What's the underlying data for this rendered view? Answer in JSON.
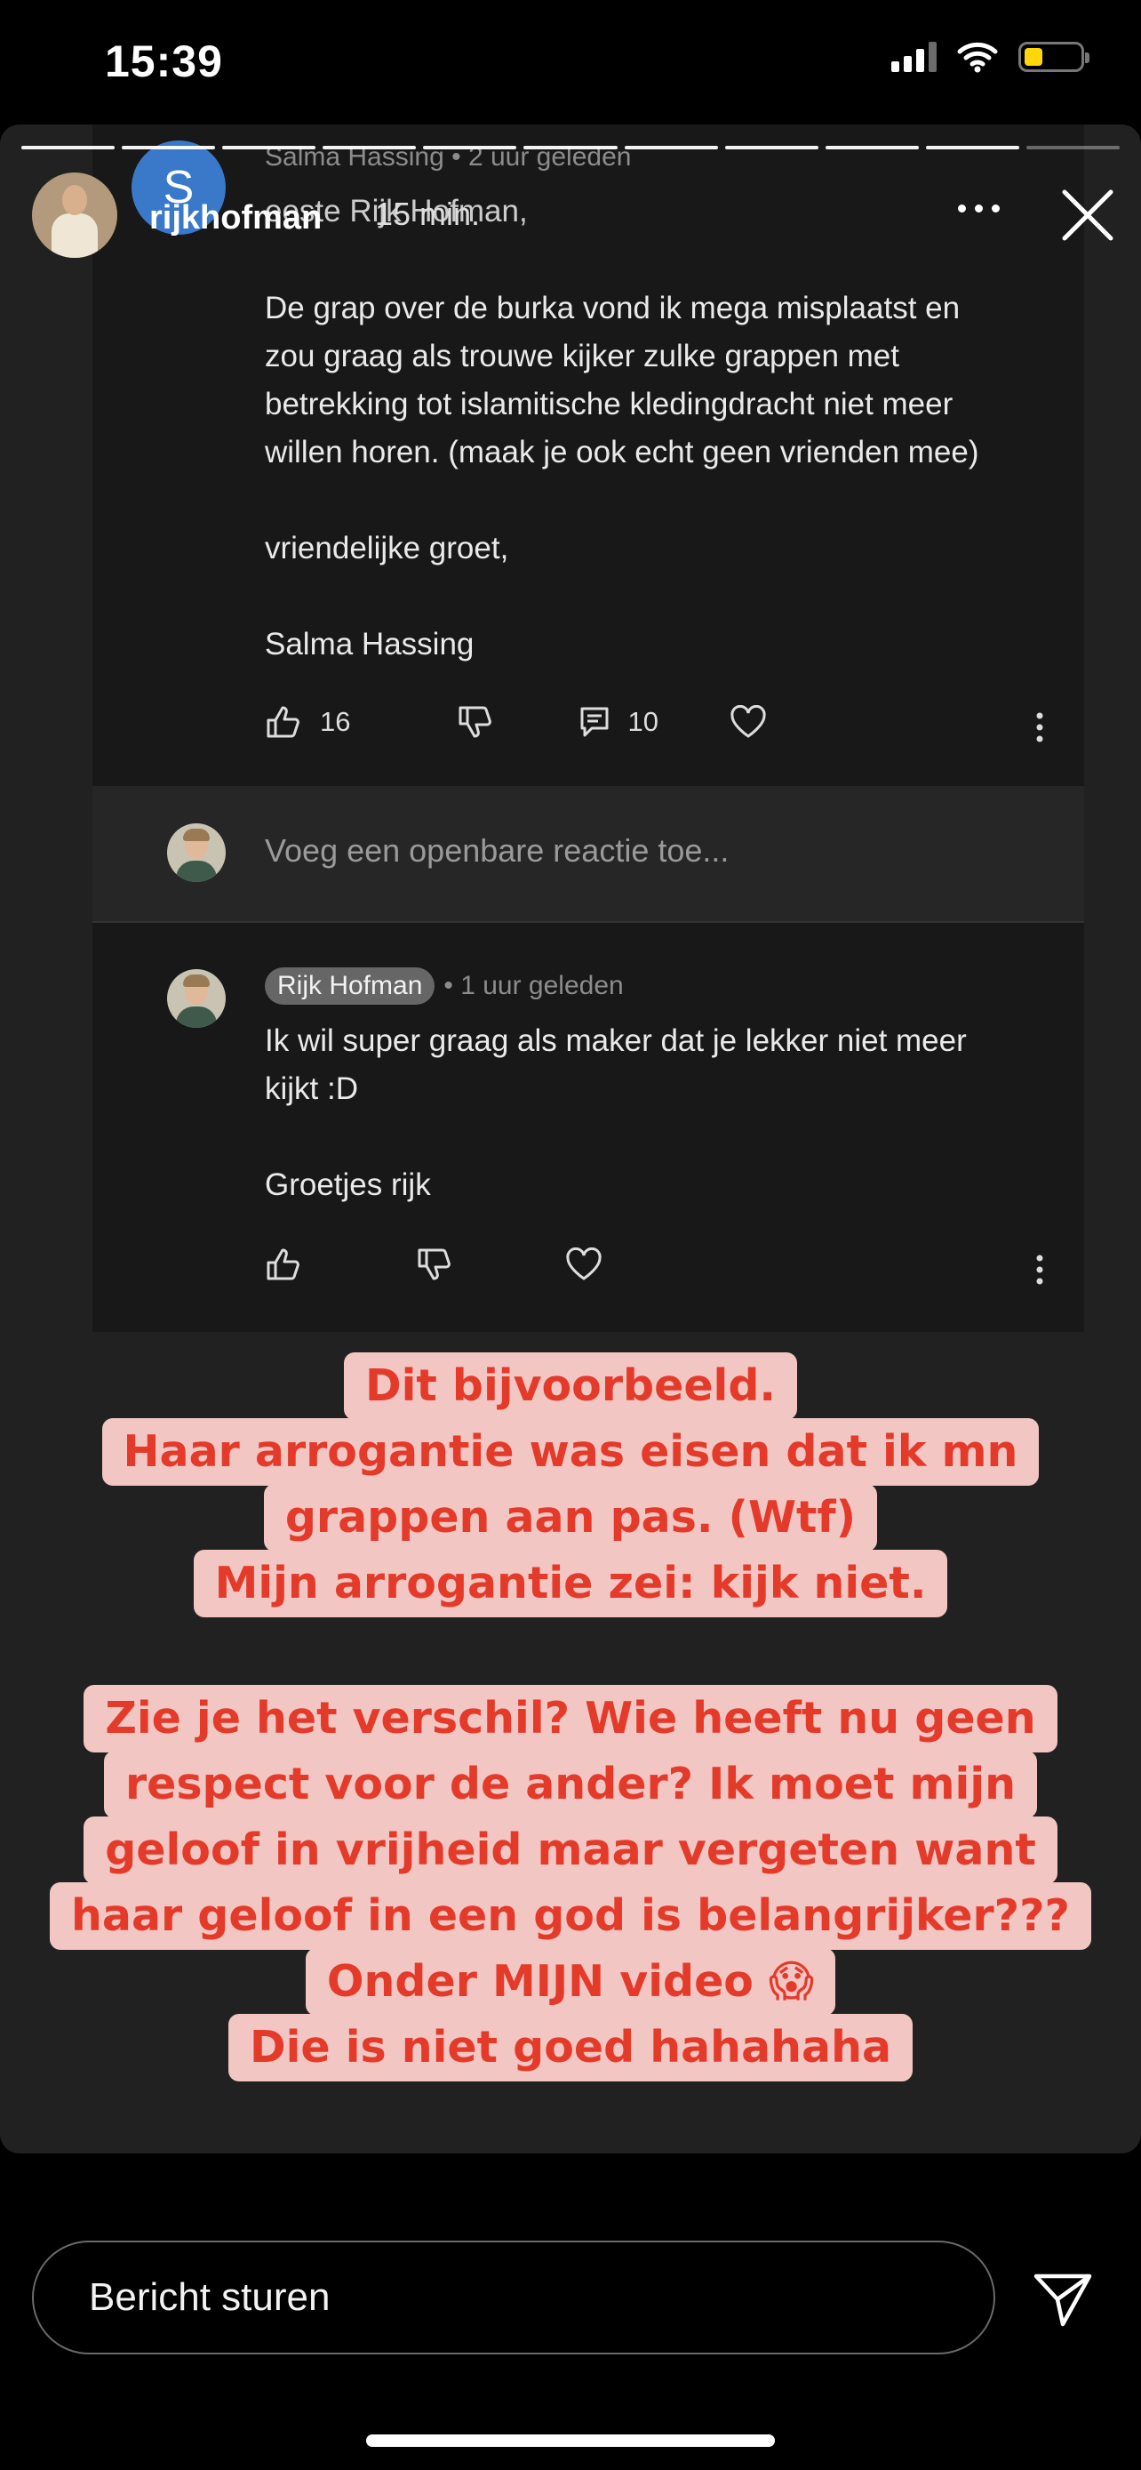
{
  "status_bar": {
    "time": "15:39"
  },
  "story": {
    "username": "rijkhofman",
    "progress": {
      "total_segments": 11,
      "completed_segments": 10
    }
  },
  "screenshot": {
    "comment": {
      "avatar_letter": "S",
      "author": "Salma Hassing",
      "time": "• 2 uur geleden",
      "salutation_fragment": "eeste Rijk Hofman,",
      "overlay_time_fragment": "15 min.",
      "body": "De grap over de burka vond ik mega misplaatst en\nzou graag als trouwe kijker zulke grappen met\nbetrekking tot islamitische kledingdracht niet meer\nwillen horen. (maak je ook echt geen vrienden mee)",
      "closing": "vriendelijke groet,",
      "signature": "Salma Hassing",
      "likes": "16",
      "replies": "10"
    },
    "reply_input_placeholder": "Voeg een openbare reactie toe...",
    "reply": {
      "author_badge": "Rijk Hofman",
      "time": "• 1 uur geleden",
      "body": "Ik wil super graag als maker dat je lekker niet meer\nkijkt :D",
      "signoff": "Groetjes rijk"
    }
  },
  "captions": {
    "block1": [
      "Dit bijvoorbeeld.",
      "Haar arrogantie was eisen dat ik mn",
      "grappen aan pas. (Wtf)",
      "Mijn arrogantie zei: kijk niet."
    ],
    "block2": [
      "Zie je het verschil? Wie heeft nu geen",
      "respect voor de ander? Ik moet mijn",
      "geloof in vrijheid maar vergeten want",
      "haar geloof in een god is belangrijker???",
      "Onder MIJN video 😱",
      "Die is niet goed hahahaha"
    ]
  },
  "bottom_bar": {
    "message_placeholder": "Bericht sturen"
  },
  "colors": {
    "caption_text": "#e33a2a",
    "caption_bg": "#f2c6c2",
    "story_bg": "#212121",
    "card_bg": "#181818"
  },
  "icons": [
    "signal-icon",
    "wifi-icon",
    "battery-icon",
    "more-icon",
    "close-icon",
    "thumbs-up-icon",
    "thumbs-down-icon",
    "reply-icon",
    "heart-icon",
    "kebab-icon",
    "send-icon"
  ]
}
